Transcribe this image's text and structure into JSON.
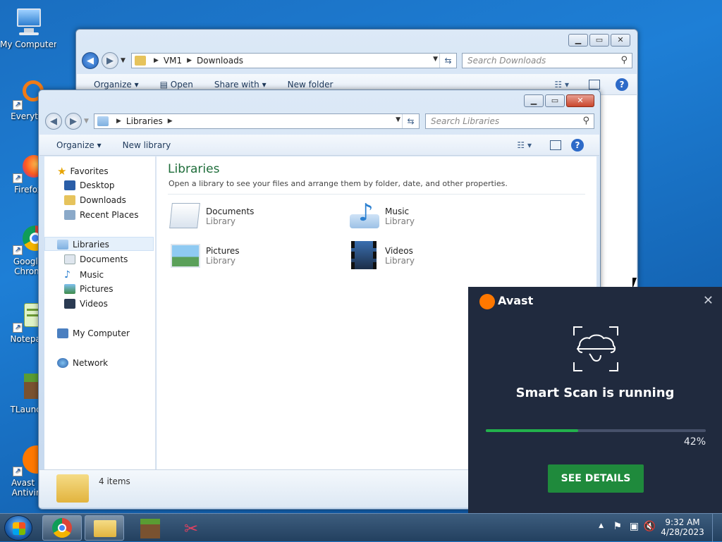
{
  "desktop": {
    "icons": [
      {
        "label": "My Computer",
        "icon": "computer-icon"
      },
      {
        "label": "Everythi",
        "icon": "everything-search-icon"
      },
      {
        "label": "Firefox",
        "icon": "firefox-icon"
      },
      {
        "label": "Google",
        "label2": "Chrom",
        "icon": "chrome-icon"
      },
      {
        "label": "Notepad",
        "icon": "notepad-icon"
      },
      {
        "label": "TLaunch",
        "icon": "minecraft-icon"
      },
      {
        "label": "Avast Fr",
        "label2": "Antiviru",
        "icon": "avast-icon"
      }
    ]
  },
  "back_window": {
    "path": [
      "VM1",
      "Downloads"
    ],
    "search_placeholder": "Search Downloads",
    "toolbar": {
      "organize": "Organize",
      "open": "Open",
      "share_with": "Share with",
      "new_folder": "New folder"
    }
  },
  "front_window": {
    "path": [
      "Libraries"
    ],
    "search_placeholder": "Search Libraries",
    "toolbar": {
      "organize": "Organize",
      "new_library": "New library"
    },
    "nav": {
      "favorites": "Favorites",
      "favorites_items": [
        "Desktop",
        "Downloads",
        "Recent Places"
      ],
      "libraries": "Libraries",
      "libraries_items": [
        "Documents",
        "Music",
        "Pictures",
        "Videos"
      ],
      "my_computer": "My Computer",
      "network": "Network"
    },
    "content": {
      "title": "Libraries",
      "subtitle": "Open a library to see your files and arrange them by folder, date, and other properties.",
      "items": [
        {
          "name": "Documents",
          "type": "Library"
        },
        {
          "name": "Music",
          "type": "Library"
        },
        {
          "name": "Pictures",
          "type": "Library"
        },
        {
          "name": "Videos",
          "type": "Library"
        }
      ]
    },
    "status": {
      "count": "4 items"
    }
  },
  "avast": {
    "brand": "Avast",
    "message": "Smart Scan is running",
    "progress_value": 0.42,
    "progress_label": "42%",
    "button": "SEE DETAILS",
    "colors": {
      "accent": "#1f8a3c",
      "background": "#202a3e",
      "brand": "#ff7800"
    }
  },
  "taskbar": {
    "apps": [
      "chrome-icon",
      "explorer-folder-icon",
      "minecraft-icon",
      "snipping-tool-icon"
    ],
    "time": "9:32 AM",
    "date": "4/28/2023"
  }
}
